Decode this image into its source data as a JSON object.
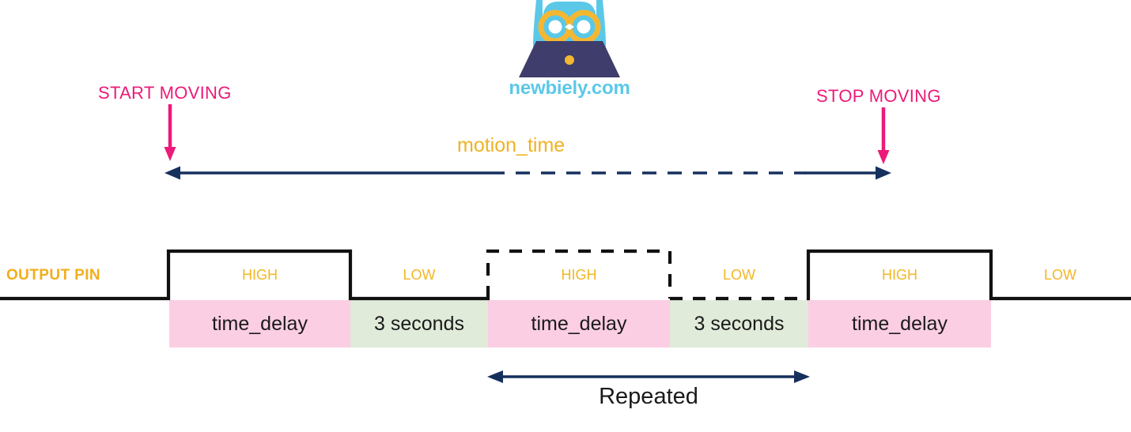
{
  "brand": {
    "site_name": "newbiely.com",
    "logo_icon": "owl-with-laptop-icon",
    "owl_color": "#5BC8E8",
    "glasses_color": "#F5B731",
    "laptop_color": "#3E3D6B",
    "text_color": "#5BC8E8"
  },
  "events": {
    "start": {
      "label": "START MOVING",
      "color": "#EC1A79",
      "arrow_icon": "arrow-down-icon"
    },
    "stop": {
      "label": "STOP MOVING",
      "color": "#EC1A79",
      "arrow_icon": "arrow-down-icon"
    }
  },
  "motion_span": {
    "label": "motion_time",
    "label_color": "#F0B323",
    "arrow_icon": "double-headed-arrow-icon",
    "arrow_color": "#16305E",
    "style": "solid-dashed-solid"
  },
  "waveform": {
    "signal_label": "OUTPUT PIN",
    "signal_label_color": "#F2AE1C",
    "level_label_color": "#F2B723",
    "line_color": "#111111",
    "segments": [
      {
        "level": "LOW",
        "duration": "",
        "band": "none",
        "edge": "solid"
      },
      {
        "level": "HIGH",
        "duration": "time_delay",
        "band": "pink",
        "edge": "solid"
      },
      {
        "level": "LOW",
        "duration": "3 seconds",
        "band": "green",
        "edge": "solid"
      },
      {
        "level": "HIGH",
        "duration": "time_delay",
        "band": "pink",
        "edge": "dashed"
      },
      {
        "level": "LOW",
        "duration": "3 seconds",
        "band": "green",
        "edge": "dashed"
      },
      {
        "level": "HIGH",
        "duration": "time_delay",
        "band": "pink",
        "edge": "solid"
      },
      {
        "level": "LOW",
        "duration": "",
        "band": "none",
        "edge": "solid"
      }
    ],
    "band_pink_color": "#FBCEE3",
    "band_green_color": "#E0EBD9"
  },
  "repeat_span": {
    "label": "Repeated",
    "arrow_icon": "double-headed-arrow-icon",
    "arrow_color": "#16305E"
  }
}
